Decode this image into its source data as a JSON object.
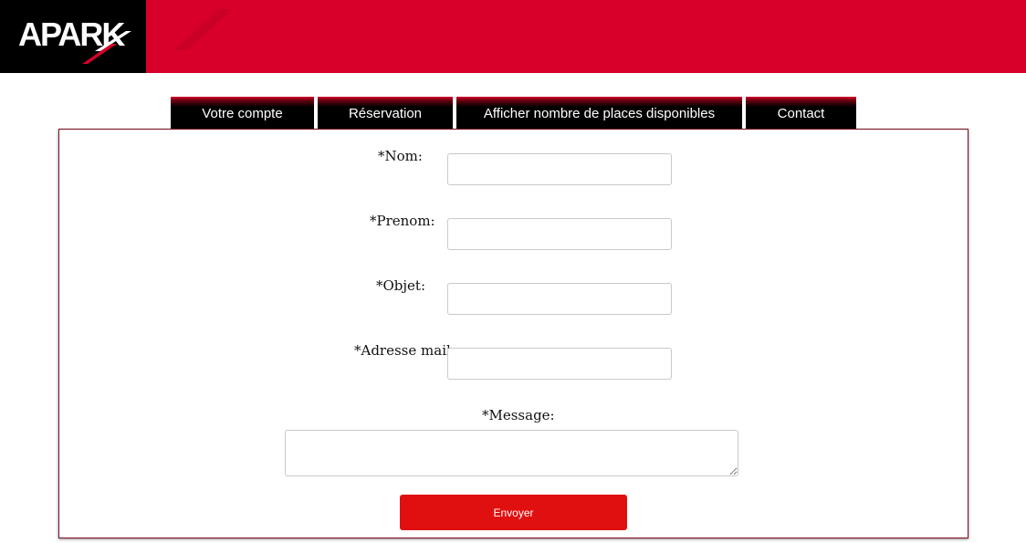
{
  "brand": {
    "logo_text": "APARK"
  },
  "nav": {
    "items": [
      {
        "label": "Votre compte"
      },
      {
        "label": "Réservation"
      },
      {
        "label": "Afficher nombre de places disponibles"
      },
      {
        "label": "Contact"
      }
    ]
  },
  "form": {
    "nom_label": "*Nom:",
    "nom_value": "",
    "prenom_label": "*Prenom:",
    "prenom_value": "",
    "objet_label": "*Objet:",
    "objet_value": "",
    "email_label": "*Adresse mail:",
    "email_value": "",
    "message_label": "*Message:",
    "message_value": "",
    "submit_label": "Envoyer"
  },
  "colors": {
    "header_red": "#d8002a",
    "logo_black": "#000000",
    "button_red": "#e01010",
    "panel_border": "#7a1020"
  }
}
